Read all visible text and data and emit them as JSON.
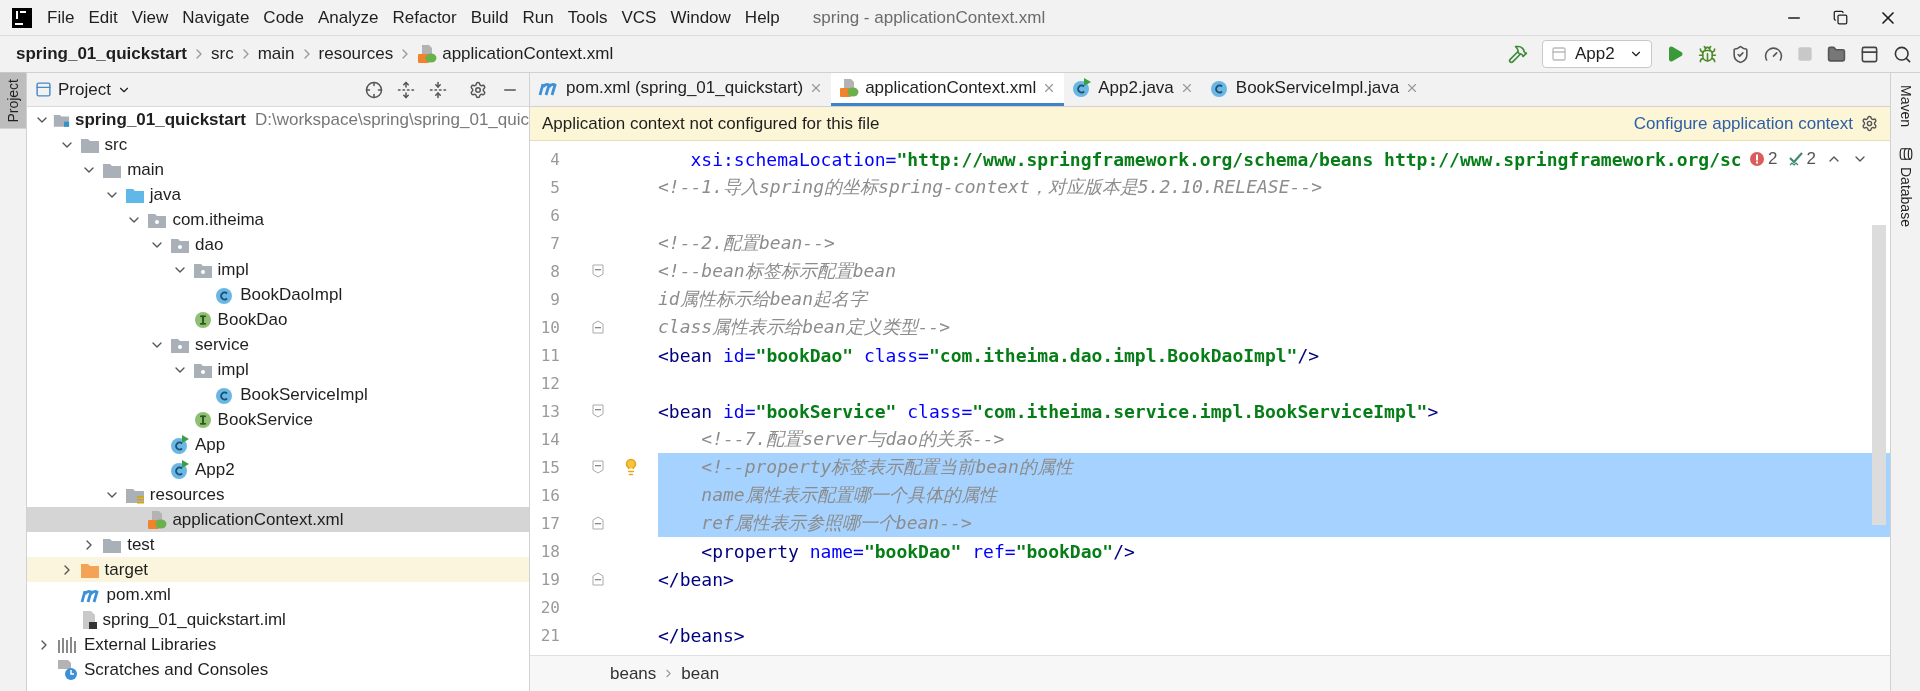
{
  "menu_bar": {
    "items": [
      "File",
      "Edit",
      "View",
      "Navigate",
      "Code",
      "Analyze",
      "Refactor",
      "Build",
      "Run",
      "Tools",
      "VCS",
      "Window",
      "Help"
    ],
    "title": "spring - applicationContext.xml"
  },
  "navigation_bar": {
    "breadcrumbs": [
      {
        "label": "spring_01_quickstart",
        "kind": "module"
      },
      {
        "label": "src",
        "kind": "folder"
      },
      {
        "label": "main",
        "kind": "folder"
      },
      {
        "label": "resources",
        "kind": "folder"
      },
      {
        "label": "applicationContext.xml",
        "kind": "spring-xml"
      }
    ],
    "run_configuration": "App2"
  },
  "left_tool_strip": {
    "tabs": [
      {
        "label": "Project",
        "selected": true
      }
    ]
  },
  "project_panel": {
    "title": "Project",
    "tree": [
      {
        "label": "spring_01_quickstart",
        "path": "D:\\workspace\\spring\\spring_01_quic",
        "kind": "module",
        "expanded": true,
        "selected": false,
        "children": [
          {
            "label": "src",
            "kind": "folder",
            "expanded": true,
            "selected": false,
            "children": [
              {
                "label": "main",
                "kind": "folder",
                "expanded": true,
                "selected": false,
                "children": [
                  {
                    "label": "java",
                    "kind": "source-folder",
                    "expanded": true,
                    "selected": false,
                    "children": [
                      {
                        "label": "com.itheima",
                        "kind": "package",
                        "expanded": true,
                        "selected": false,
                        "children": [
                          {
                            "label": "dao",
                            "kind": "package",
                            "expanded": true,
                            "selected": false,
                            "children": [
                              {
                                "label": "impl",
                                "kind": "package",
                                "expanded": true,
                                "selected": false,
                                "children": [
                                  {
                                    "label": "BookDaoImpl",
                                    "kind": "class",
                                    "selected": false
                                  }
                                ]
                              },
                              {
                                "label": "BookDao",
                                "kind": "interface",
                                "selected": false
                              }
                            ]
                          },
                          {
                            "label": "service",
                            "kind": "package",
                            "expanded": true,
                            "selected": false,
                            "children": [
                              {
                                "label": "impl",
                                "kind": "package",
                                "expanded": true,
                                "selected": false,
                                "children": [
                                  {
                                    "label": "BookServiceImpl",
                                    "kind": "class",
                                    "selected": false
                                  }
                                ]
                              },
                              {
                                "label": "BookService",
                                "kind": "interface",
                                "selected": false
                              }
                            ]
                          },
                          {
                            "label": "App",
                            "kind": "app-class",
                            "selected": false
                          },
                          {
                            "label": "App2",
                            "kind": "app-class",
                            "selected": false
                          }
                        ]
                      }
                    ]
                  },
                  {
                    "label": "resources",
                    "kind": "resources-folder",
                    "expanded": true,
                    "selected": false,
                    "children": [
                      {
                        "label": "applicationContext.xml",
                        "kind": "spring-xml",
                        "selected": true
                      }
                    ]
                  }
                ]
              },
              {
                "label": "test",
                "kind": "folder",
                "expanded": false,
                "selected": false
              }
            ]
          },
          {
            "label": "target",
            "kind": "excluded-folder",
            "expanded": false,
            "selected": false
          },
          {
            "label": "pom.xml",
            "kind": "maven",
            "selected": false
          },
          {
            "label": "spring_01_quickstart.iml",
            "kind": "iml",
            "selected": false
          }
        ]
      },
      {
        "label": "External Libraries",
        "kind": "libraries",
        "expanded": false,
        "selected": false
      },
      {
        "label": "Scratches and Consoles",
        "kind": "scratches",
        "selected": false
      }
    ]
  },
  "editor": {
    "tabs": [
      {
        "label": "pom.xml (spring_01_quickstart)",
        "kind": "maven",
        "selected": false
      },
      {
        "label": "applicationContext.xml",
        "kind": "spring-xml",
        "selected": true
      },
      {
        "label": "App2.java",
        "kind": "app-class",
        "selected": false
      },
      {
        "label": "BookServiceImpl.java",
        "kind": "class",
        "selected": false
      }
    ],
    "banner": {
      "message": "Application context not configured for this file",
      "action": "Configure application context"
    },
    "inspections": {
      "errors": "2",
      "warnings": "2"
    },
    "lines": [
      {
        "number": "4",
        "selected": false,
        "bulb": false,
        "fold_start": false,
        "fold_end": false,
        "segments": [
          {
            "kind": "attr",
            "text": "   xsi:schemaLocation="
          },
          {
            "kind": "value",
            "text": "\"http://www.springframework.org/schema/beans http://www.springframework.org/sc"
          }
        ]
      },
      {
        "number": "5",
        "selected": false,
        "bulb": false,
        "fold_start": false,
        "fold_end": false,
        "segments": [
          {
            "kind": "comment",
            "text": "<!--1.导入spring的坐标spring-context，对应版本是5.2.10.RELEASE-->"
          }
        ]
      },
      {
        "number": "6",
        "selected": false,
        "bulb": false,
        "fold_start": false,
        "fold_end": false
      },
      {
        "number": "7",
        "selected": false,
        "bulb": false,
        "fold_start": false,
        "fold_end": false,
        "segments": [
          {
            "kind": "comment",
            "text": "<!--2.配置bean-->"
          }
        ]
      },
      {
        "number": "8",
        "selected": false,
        "bulb": false,
        "fold_start": true,
        "fold_end": false,
        "segments": [
          {
            "kind": "comment",
            "text": "<!--bean标签标示配置bean"
          }
        ]
      },
      {
        "number": "9",
        "selected": false,
        "bulb": false,
        "fold_start": false,
        "fold_end": false,
        "segments": [
          {
            "kind": "comment",
            "text": "id属性标示给bean起名字"
          }
        ]
      },
      {
        "number": "10",
        "selected": false,
        "bulb": false,
        "fold_start": false,
        "fold_end": true,
        "segments": [
          {
            "kind": "comment",
            "text": "class属性表示给bean定义类型-->"
          }
        ]
      },
      {
        "number": "11",
        "selected": false,
        "bulb": false,
        "fold_start": false,
        "fold_end": false,
        "segments": [
          {
            "kind": "tag",
            "text": "<bean "
          },
          {
            "kind": "attr",
            "text": "id="
          },
          {
            "kind": "value",
            "text": "\"bookDao\" "
          },
          {
            "kind": "attr",
            "text": "class="
          },
          {
            "kind": "value",
            "text": "\"com.itheima.dao.impl.BookDaoImpl\""
          },
          {
            "kind": "tag",
            "text": "/>"
          }
        ]
      },
      {
        "number": "12",
        "selected": false,
        "bulb": false,
        "fold_start": false,
        "fold_end": false
      },
      {
        "number": "13",
        "selected": false,
        "bulb": false,
        "fold_start": true,
        "fold_end": false,
        "segments": [
          {
            "kind": "tag",
            "text": "<bean "
          },
          {
            "kind": "attr",
            "text": "id="
          },
          {
            "kind": "value",
            "text": "\"bookService\" "
          },
          {
            "kind": "attr",
            "text": "class="
          },
          {
            "kind": "value",
            "text": "\"com.itheima.service.impl.BookServiceImpl\""
          },
          {
            "kind": "tag",
            "text": ">"
          }
        ]
      },
      {
        "number": "14",
        "selected": false,
        "bulb": false,
        "fold_start": false,
        "fold_end": false,
        "segments": [
          {
            "kind": "comment",
            "text": "    <!--7.配置server与dao的关系-->"
          }
        ]
      },
      {
        "number": "15",
        "selected": true,
        "bulb": true,
        "fold_start": true,
        "fold_end": false,
        "segments": [
          {
            "kind": "comment",
            "text": "    <!--property标签表示配置当前bean的属性"
          }
        ]
      },
      {
        "number": "16",
        "selected": true,
        "bulb": false,
        "fold_start": false,
        "fold_end": false,
        "segments": [
          {
            "kind": "comment",
            "text": "    name属性表示配置哪一个具体的属性"
          }
        ]
      },
      {
        "number": "17",
        "selected": true,
        "bulb": false,
        "fold_start": false,
        "fold_end": true,
        "segments": [
          {
            "kind": "comment",
            "text": "    ref属性表示参照哪一个bean-->"
          }
        ]
      },
      {
        "number": "18",
        "selected": false,
        "bulb": false,
        "fold_start": false,
        "fold_end": false,
        "segments": [
          {
            "kind": "tag",
            "text": "    <property "
          },
          {
            "kind": "attr",
            "text": "name="
          },
          {
            "kind": "value",
            "text": "\"bookDao\" "
          },
          {
            "kind": "attr",
            "text": "ref="
          },
          {
            "kind": "value",
            "text": "\"bookDao\""
          },
          {
            "kind": "tag",
            "text": "/>"
          }
        ]
      },
      {
        "number": "19",
        "selected": false,
        "bulb": false,
        "fold_start": false,
        "fold_end": true,
        "segments": [
          {
            "kind": "tag",
            "text": "</bean>"
          }
        ]
      },
      {
        "number": "20",
        "selected": false,
        "bulb": false,
        "fold_start": false,
        "fold_end": false
      },
      {
        "number": "21",
        "selected": false,
        "bulb": false,
        "fold_start": false,
        "fold_end": false,
        "segments": [
          {
            "kind": "tag",
            "text": "</beans>"
          }
        ]
      }
    ],
    "breadcrumbs": [
      "beans",
      "bean"
    ]
  },
  "right_tool_strip": {
    "tabs": [
      "Maven",
      "Database"
    ]
  }
}
